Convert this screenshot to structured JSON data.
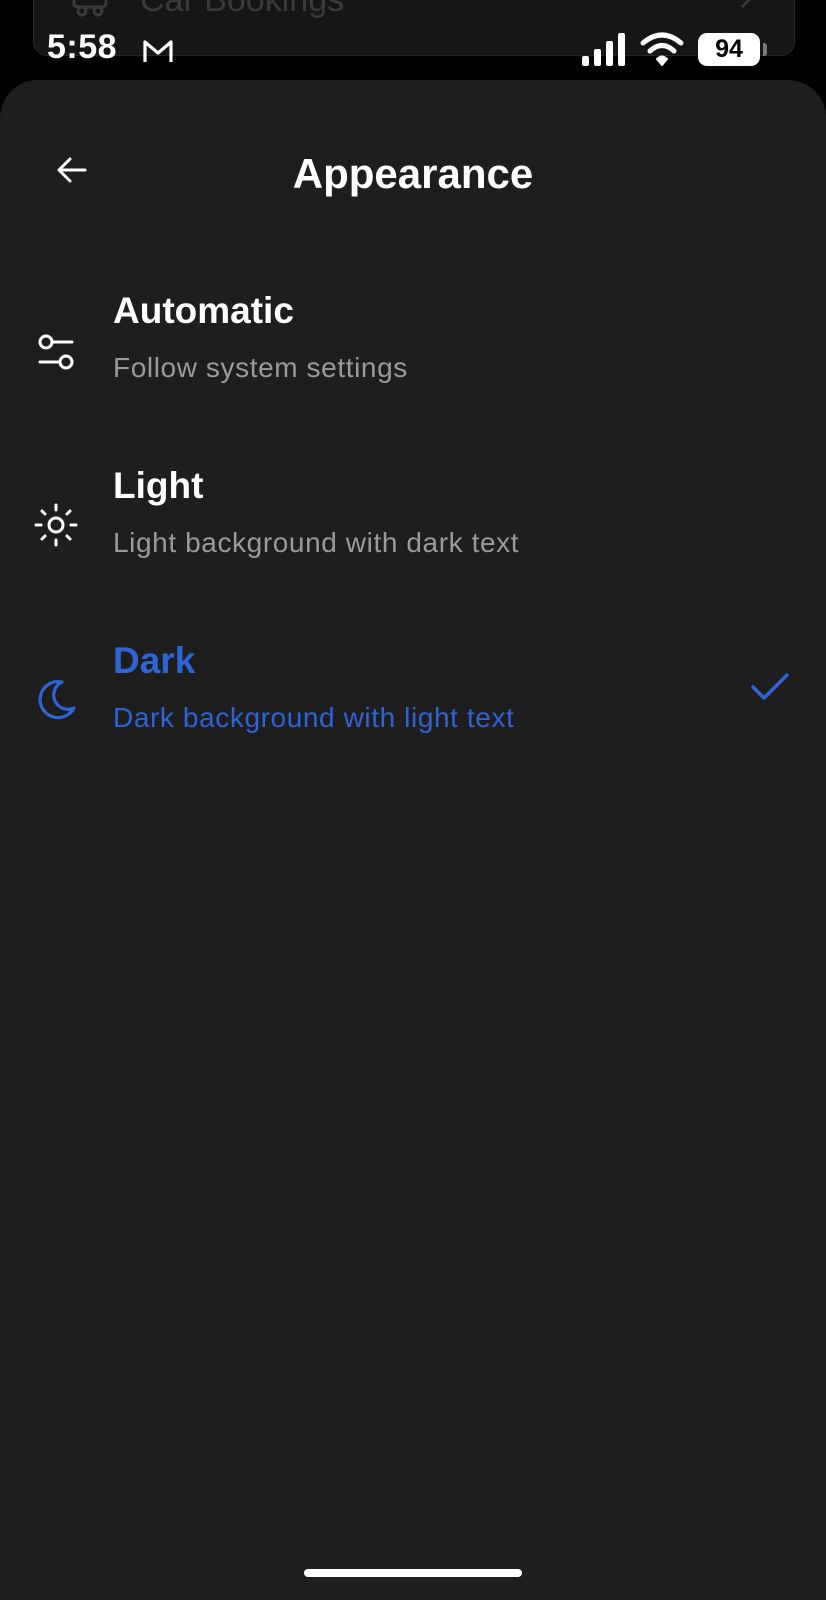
{
  "background_page": {
    "row_label": "Car Bookings"
  },
  "status_bar": {
    "time": "5:58",
    "battery_level": "94",
    "notification_icon": "gmail-icon"
  },
  "header": {
    "title": "Appearance",
    "back_icon": "arrow-left-icon"
  },
  "options": [
    {
      "label": "Automatic",
      "description": "Follow system settings",
      "icon": "sliders-toggle-icon",
      "selected": false
    },
    {
      "label": "Light",
      "description": "Light background with dark text",
      "icon": "sun-icon",
      "selected": false
    },
    {
      "label": "Dark",
      "description": "Dark background with light text",
      "icon": "moon-icon",
      "selected": true
    }
  ],
  "colors": {
    "background": "#1e1e1e",
    "accent": "#2f63d8",
    "primary_text": "#ffffff",
    "secondary_text": "#9a9a9a"
  }
}
